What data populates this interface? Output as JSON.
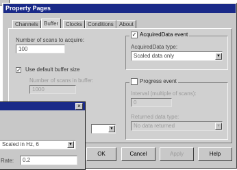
{
  "window": {
    "title": "Property Pages"
  },
  "tabs": [
    {
      "label": "Channels"
    },
    {
      "label": "Buffer"
    },
    {
      "label": "Clocks"
    },
    {
      "label": "Conditions"
    },
    {
      "label": "About"
    }
  ],
  "left": {
    "scans_label": "Number of scans to acquire:",
    "scans_value": "100",
    "default_buffer_label": "Use default buffer size",
    "default_buffer_checked": true,
    "scans_in_buffer_label": "Number of scans in buffer:",
    "scans_in_buffer_value": "1000"
  },
  "acquired_data": {
    "title": "AcquiredData event",
    "checked": true,
    "units_label": "AcquiredData type:",
    "units_value": "Scaled data only"
  },
  "progress": {
    "title": "Progress event",
    "checked": false,
    "interval_label": "Interval (multiple of scans):",
    "interval_value": "0",
    "units_label": "Returned data type:",
    "units_value": "No data returned"
  },
  "buttons": {
    "ok": "OK",
    "cancel": "Cancel",
    "apply": "Apply",
    "help": "Help"
  },
  "sub_dialog": {
    "field1_value": "Scaled in Hz, 6",
    "field2_label": "Rate:",
    "field2_value": "0.2"
  },
  "icons": {
    "close": "close-icon",
    "dropdown": "chevron-down-icon"
  },
  "colors": {
    "titlebar": "#1a2a88",
    "face": "#c8c8c8"
  }
}
